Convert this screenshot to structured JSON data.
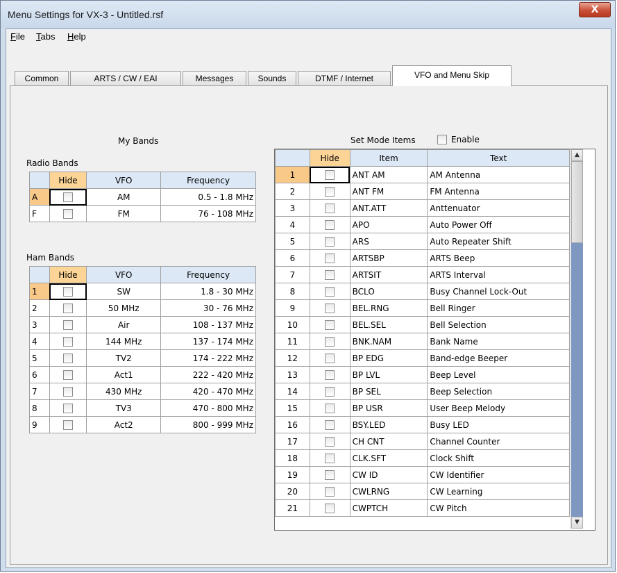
{
  "window": {
    "title": "Menu Settings for VX-3 - Untitled.rsf",
    "close_label": "X"
  },
  "menu": {
    "file_hotkey": "F",
    "file_rest": "ile",
    "tabs_hotkey": "T",
    "tabs_rest": "abs",
    "help_hotkey": "H",
    "help_rest": "elp"
  },
  "tabs": {
    "common": "Common",
    "arts": "ARTS / CW / EAI",
    "messages": "Messages",
    "sounds": "Sounds",
    "dtmf": "DTMF / Internet",
    "vfo": "VFO and Menu Skip"
  },
  "my_bands": {
    "title": "My Bands",
    "radio_label": "Radio Bands",
    "ham_label": "Ham Bands",
    "headers": {
      "hide": "Hide",
      "vfo": "VFO",
      "freq": "Frequency"
    },
    "radio_rows": [
      {
        "id": "A",
        "vfo": "AM",
        "freq": "0.5 - 1.8 MHz"
      },
      {
        "id": "F",
        "vfo": "FM",
        "freq": "76 - 108 MHz"
      }
    ],
    "ham_rows": [
      {
        "id": "1",
        "vfo": "SW",
        "freq": "1.8 - 30 MHz"
      },
      {
        "id": "2",
        "vfo": "50 MHz",
        "freq": "30 - 76 MHz"
      },
      {
        "id": "3",
        "vfo": "Air",
        "freq": "108 - 137 MHz"
      },
      {
        "id": "4",
        "vfo": "144 MHz",
        "freq": "137 - 174 MHz"
      },
      {
        "id": "5",
        "vfo": "TV2",
        "freq": "174 - 222 MHz"
      },
      {
        "id": "6",
        "vfo": "Act1",
        "freq": "222 - 420 MHz"
      },
      {
        "id": "7",
        "vfo": "430 MHz",
        "freq": "420 - 470 MHz"
      },
      {
        "id": "8",
        "vfo": "TV3",
        "freq": "470 - 800 MHz"
      },
      {
        "id": "9",
        "vfo": "Act2",
        "freq": "800 - 999 MHz"
      }
    ]
  },
  "set_mode": {
    "title": "Set Mode Items",
    "enable_label": "Enable",
    "headers": {
      "hide": "Hide",
      "item": "Item",
      "text": "Text"
    },
    "rows": [
      {
        "id": "1",
        "item": "ANT AM",
        "text": "AM Antenna"
      },
      {
        "id": "2",
        "item": "ANT FM",
        "text": "FM Antenna"
      },
      {
        "id": "3",
        "item": "ANT.ATT",
        "text": "Anttenuator"
      },
      {
        "id": "4",
        "item": "APO",
        "text": "Auto Power Off"
      },
      {
        "id": "5",
        "item": "ARS",
        "text": "Auto Repeater Shift"
      },
      {
        "id": "6",
        "item": "ARTSBP",
        "text": "ARTS Beep"
      },
      {
        "id": "7",
        "item": "ARTSIT",
        "text": "ARTS Interval"
      },
      {
        "id": "8",
        "item": "BCLO",
        "text": "Busy Channel Lock-Out"
      },
      {
        "id": "9",
        "item": "BEL.RNG",
        "text": "Bell Ringer"
      },
      {
        "id": "10",
        "item": "BEL.SEL",
        "text": "Bell Selection"
      },
      {
        "id": "11",
        "item": "BNK.NAM",
        "text": "Bank Name"
      },
      {
        "id": "12",
        "item": "BP EDG",
        "text": "Band-edge Beeper"
      },
      {
        "id": "13",
        "item": "BP LVL",
        "text": "Beep Level"
      },
      {
        "id": "14",
        "item": "BP SEL",
        "text": "Beep Selection"
      },
      {
        "id": "15",
        "item": "BP USR",
        "text": "User Beep Melody"
      },
      {
        "id": "16",
        "item": "BSY.LED",
        "text": "Busy LED"
      },
      {
        "id": "17",
        "item": "CH CNT",
        "text": "Channel Counter"
      },
      {
        "id": "18",
        "item": "CLK.SFT",
        "text": "Clock Shift"
      },
      {
        "id": "19",
        "item": "CW ID",
        "text": "CW Identifier"
      },
      {
        "id": "20",
        "item": "CWLRNG",
        "text": "CW Learning"
      },
      {
        "id": "21",
        "item": "CWPTCH",
        "text": "CW Pitch"
      }
    ]
  },
  "colors": {
    "selected_row_header": "#f9c98a",
    "column_header": "#dce8f6",
    "scroll_fill": "#7f98c1"
  }
}
